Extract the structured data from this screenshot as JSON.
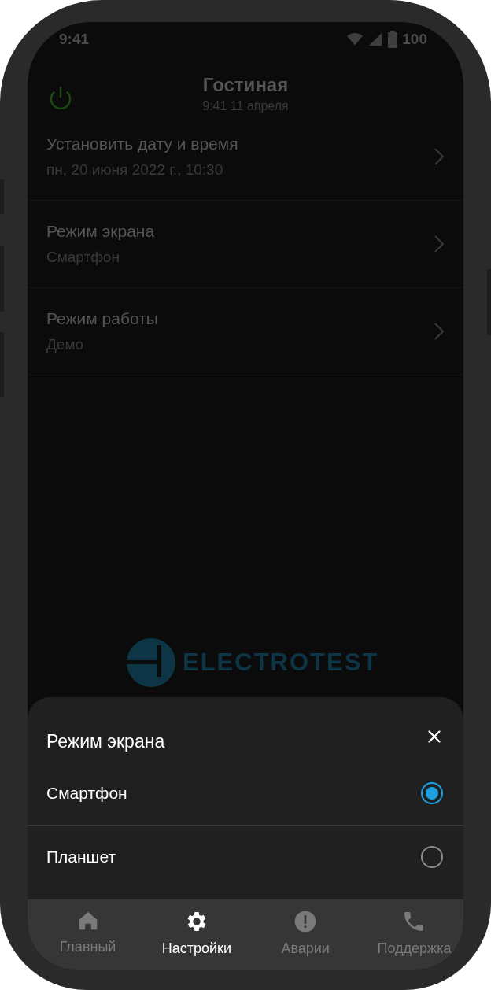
{
  "status_bar": {
    "time": "9:41",
    "battery": "100"
  },
  "header": {
    "title": "Гостиная",
    "subtitle": "9:41 11 апреля"
  },
  "settings": [
    {
      "label": "Установить дату и время",
      "value": "пн, 20 июня 2022 г., 10:30"
    },
    {
      "label": "Режим экрана",
      "value": "Смартфон"
    },
    {
      "label": "Режим работы",
      "value": "Демо"
    }
  ],
  "logo": {
    "text": "ELECTROTEST"
  },
  "sheet": {
    "title": "Режим экрана",
    "options": [
      {
        "label": "Смартфон",
        "selected": true
      },
      {
        "label": "Планшет",
        "selected": false
      }
    ]
  },
  "nav": [
    {
      "kind": "home",
      "label": "Главный",
      "selected": false
    },
    {
      "kind": "settings",
      "label": "Настройки",
      "selected": true
    },
    {
      "kind": "alerts",
      "label": "Аварии",
      "selected": false
    },
    {
      "kind": "support",
      "label": "Поддержка",
      "selected": false
    }
  ]
}
